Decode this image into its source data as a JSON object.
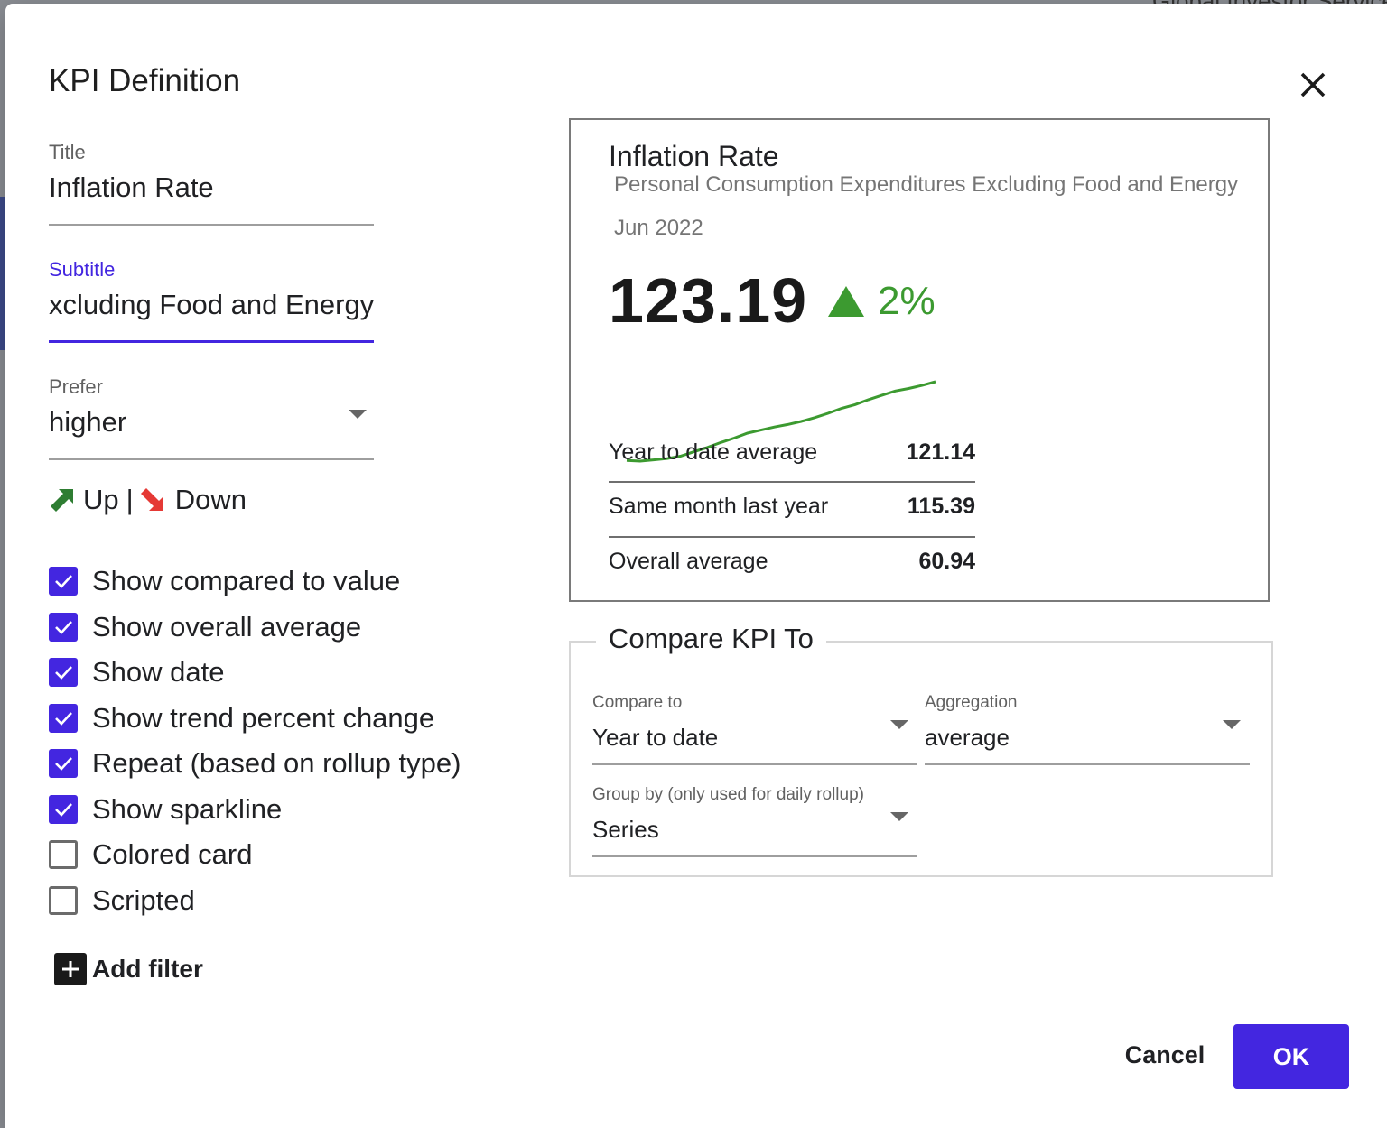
{
  "dialog": {
    "title": "KPI Definition"
  },
  "background": {
    "top_text": "Global Investor Services"
  },
  "form": {
    "title_label": "Title",
    "title_value": "Inflation Rate",
    "subtitle_label": "Subtitle",
    "subtitle_value": "xcluding Food and Energy",
    "prefer_label": "Prefer",
    "prefer_value": "higher",
    "legend_up": "Up",
    "legend_sep": "|",
    "legend_down": "Down"
  },
  "checkboxes": [
    {
      "label": "Show compared to value",
      "checked": true
    },
    {
      "label": "Show overall average",
      "checked": true
    },
    {
      "label": "Show date",
      "checked": true
    },
    {
      "label": "Show trend percent change",
      "checked": true
    },
    {
      "label": "Repeat (based on rollup type)",
      "checked": true
    },
    {
      "label": "Show sparkline",
      "checked": true
    },
    {
      "label": "Colored card",
      "checked": false
    },
    {
      "label": "Scripted",
      "checked": false
    }
  ],
  "add_filter_label": "Add filter",
  "preview": {
    "title": "Inflation Rate",
    "subtitle": "Personal Consumption Expenditures Excluding Food and Energy",
    "date": "Jun 2022",
    "value": "123.19",
    "trend_percent": "2%",
    "trend_direction": "up",
    "trend_color": "#3c9a30",
    "sparkline_color": "#3c9a30",
    "sparkline_values": [
      110.5,
      110.4,
      110.6,
      110.8,
      111.2,
      111.9,
      112.6,
      113.4,
      114.1,
      114.9,
      115.4,
      115.9,
      116.3,
      116.8,
      117.4,
      118.1,
      118.9,
      119.5,
      120.3,
      121.0,
      121.7,
      122.1,
      122.6,
      123.19
    ],
    "stats": [
      {
        "label": "Year to date average",
        "value": "121.14"
      },
      {
        "label": "Same month last year",
        "value": "115.39"
      },
      {
        "label": "Overall average",
        "value": "60.94"
      }
    ]
  },
  "compare": {
    "legend": "Compare KPI To",
    "compare_to_label": "Compare to",
    "compare_to_value": "Year to date",
    "aggregation_label": "Aggregation",
    "aggregation_value": "average",
    "group_by_label": "Group by (only used for daily rollup)",
    "group_by_value": "Series"
  },
  "buttons": {
    "cancel": "Cancel",
    "ok": "OK"
  },
  "colors": {
    "accent": "#4326e0",
    "up_arrow": "#2e7d32",
    "down_arrow": "#e53935"
  }
}
